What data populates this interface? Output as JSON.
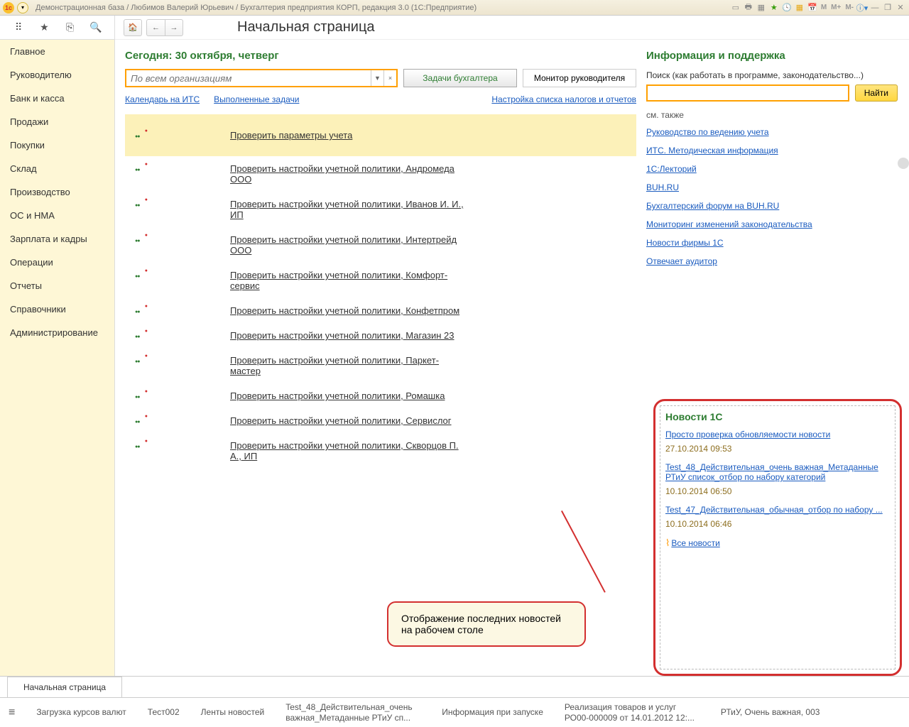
{
  "titlebar": {
    "text": "Демонстрационная база / Любимов Валерий Юрьевич / Бухгалтерия предприятия КОРП, редакция 3.0  (1С:Предприятие)"
  },
  "title_icons": {
    "m1": "M",
    "m2": "M+",
    "m3": "M-",
    "minimize": "—",
    "restore": "❐",
    "close": "✕"
  },
  "page_title": "Начальная страница",
  "sidebar": {
    "items": [
      "Главное",
      "Руководителю",
      "Банк и касса",
      "Продажи",
      "Покупки",
      "Склад",
      "Производство",
      "ОС и НМА",
      "Зарплата и кадры",
      "Операции",
      "Отчеты",
      "Справочники",
      "Администрирование"
    ]
  },
  "today_header": "Сегодня: 30 октября, четверг",
  "org_filter_placeholder": "По всем организациям",
  "tabs": {
    "accountant": "Задачи бухгалтера",
    "manager": "Монитор руководителя"
  },
  "links_row": {
    "calendar": "Календарь на ИТС",
    "done_tasks": "Выполненные задачи",
    "settings": "Настройка списка налогов и отчетов"
  },
  "tasks": [
    {
      "label": "Проверить параметры учета",
      "highlight": true
    },
    {
      "label": "Проверить настройки учетной политики, Андромеда ООО"
    },
    {
      "label": "Проверить настройки учетной политики, Иванов И. И., ИП"
    },
    {
      "label": "Проверить настройки учетной политики, Интертрейд ООО"
    },
    {
      "label": "Проверить настройки учетной политики, Комфорт-сервис"
    },
    {
      "label": "Проверить настройки учетной политики, Конфетпром"
    },
    {
      "label": "Проверить настройки учетной политики, Магазин 23"
    },
    {
      "label": "Проверить настройки учетной политики, Паркет-мастер"
    },
    {
      "label": "Проверить настройки учетной политики, Ромашка"
    },
    {
      "label": "Проверить настройки учетной политики, Сервислог"
    },
    {
      "label": "Проверить настройки учетной политики, Скворцов П. А., ИП"
    }
  ],
  "support": {
    "header": "Информация и поддержка",
    "search_label": "Поиск (как работать в программе, законодательство...)",
    "find_btn": "Найти",
    "see_also": "см. также",
    "links": [
      "Руководство по ведению учета",
      "ИТС. Методическая информация",
      "1С:Лекторий",
      "BUH.RU",
      "Бухгалтерский форум на BUH.RU",
      "Мониторинг изменений законодательства",
      "Новости фирмы 1С",
      "Отвечает аудитор"
    ]
  },
  "news": {
    "header": "Новости 1С",
    "items": [
      {
        "title": "Просто проверка обновляемости новости",
        "date": "27.10.2014 09:53"
      },
      {
        "title": "Test_48_Действительная_очень важная_Метаданные РТиУ список_отбор по набору категорий",
        "date": "10.10.2014 06:50"
      },
      {
        "title": "Test_47_Действительная_обычная_отбор по набору ...",
        "date": "10.10.2014 06:46"
      }
    ],
    "all_news": "Все новости"
  },
  "callout_text": "Отображение последних новостей на рабочем столе",
  "bottom_tab": "Начальная страница",
  "status_items": [
    "Загрузка курсов валют",
    "Тест002",
    "Ленты новостей",
    "Test_48_Действительная_очень важная_Метаданные РТиУ сп...",
    "Информация при запуске",
    "Реализация товаров и услуг РО00-000009 от 14.01.2012 12:...",
    "РТиУ, Очень важная, 003"
  ]
}
